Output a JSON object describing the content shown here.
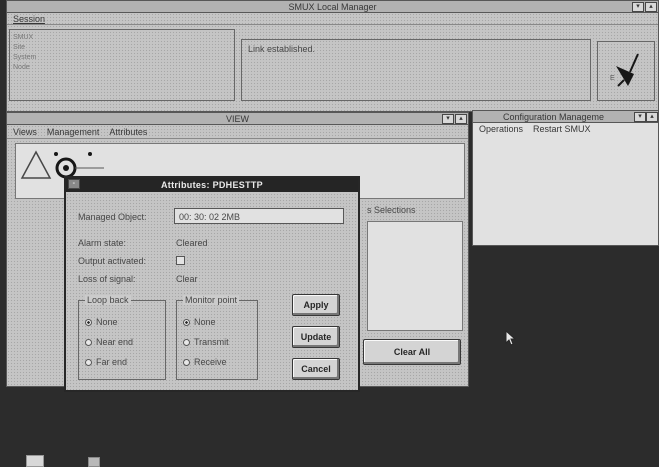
{
  "manager": {
    "title": "SMUX Local Manager",
    "menu": [
      "Session"
    ],
    "status_labels": [
      "SMUX",
      "Site",
      "System",
      "Node"
    ],
    "message": "Link established."
  },
  "view": {
    "title": "VIEW",
    "menu": [
      "Views",
      "Management",
      "Attributes"
    ],
    "selections_label": "s Selections",
    "clear_all": "Clear All"
  },
  "config": {
    "title": "Configuration Manageme",
    "menu": [
      "Operations",
      "Restart SMUX"
    ]
  },
  "dialog": {
    "title": "Attributes: PDHESTTP",
    "managed_object_label": "Managed Object:",
    "managed_object_value": "00: 30: 02 2MB",
    "alarm_state_label": "Alarm state:",
    "alarm_state_value": "Cleared",
    "output_activated_label": "Output activated:",
    "loss_of_signal_label": "Loss of signal:",
    "loss_of_signal_value": "Clear",
    "loopback": {
      "label": "Loop back",
      "options": [
        "None",
        "Near end",
        "Far end"
      ],
      "selected": "None"
    },
    "monitor": {
      "label": "Monitor point",
      "options": [
        "None",
        "Transmit",
        "Receive"
      ],
      "selected": "None"
    },
    "buttons": {
      "apply": "Apply",
      "update": "Update",
      "cancel": "Cancel"
    }
  }
}
